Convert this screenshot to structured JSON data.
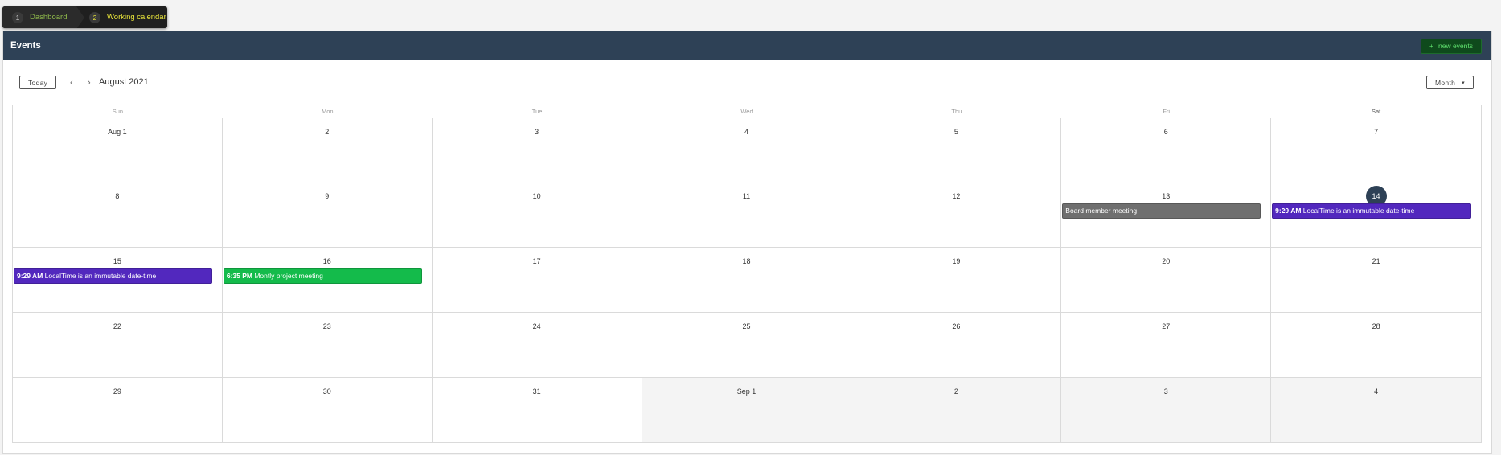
{
  "breadcrumb": {
    "items": [
      {
        "num": "1",
        "label": "Dashboard"
      },
      {
        "num": "2",
        "label": "Working calendar"
      }
    ]
  },
  "panel": {
    "title": "Events",
    "new_button": "new events",
    "new_icon": "+"
  },
  "toolbar": {
    "today_label": "Today",
    "prev": "‹",
    "next": "›",
    "title": "August 2021",
    "view_label": "Month",
    "view_caret": "▾"
  },
  "calendar": {
    "weekdays": [
      "Sun",
      "Mon",
      "Tue",
      "Wed",
      "Thu",
      "Fri",
      "Sat"
    ],
    "weeks": [
      [
        "Aug 1",
        "2",
        "3",
        "4",
        "5",
        "6",
        "7"
      ],
      [
        "8",
        "9",
        "10",
        "11",
        "12",
        "13",
        "14"
      ],
      [
        "15",
        "16",
        "17",
        "18",
        "19",
        "20",
        "21"
      ],
      [
        "22",
        "23",
        "24",
        "25",
        "26",
        "27",
        "28"
      ],
      [
        "29",
        "30",
        "31",
        "Sep 1",
        "2",
        "3",
        "4"
      ]
    ],
    "events": [
      {
        "title": "Board member meeting",
        "time": "",
        "color": "#6f6f6f"
      },
      {
        "title": "LocalTime is an immutable date-time",
        "time": "9:29 AM",
        "color": "#5228be"
      },
      {
        "title": "LocalTime is an immutable date-time",
        "time": "9:29 AM",
        "color": "#5228be"
      },
      {
        "title": "Montly project meeting",
        "time": "6:35 PM",
        "color": "#14bb4b"
      }
    ],
    "colors": {
      "header_bg": "#2e4156",
      "today_circle": "#2e4156",
      "purple_event": "#5228be",
      "gray_event": "#6f6f6f",
      "green_event": "#14bb4b"
    }
  }
}
